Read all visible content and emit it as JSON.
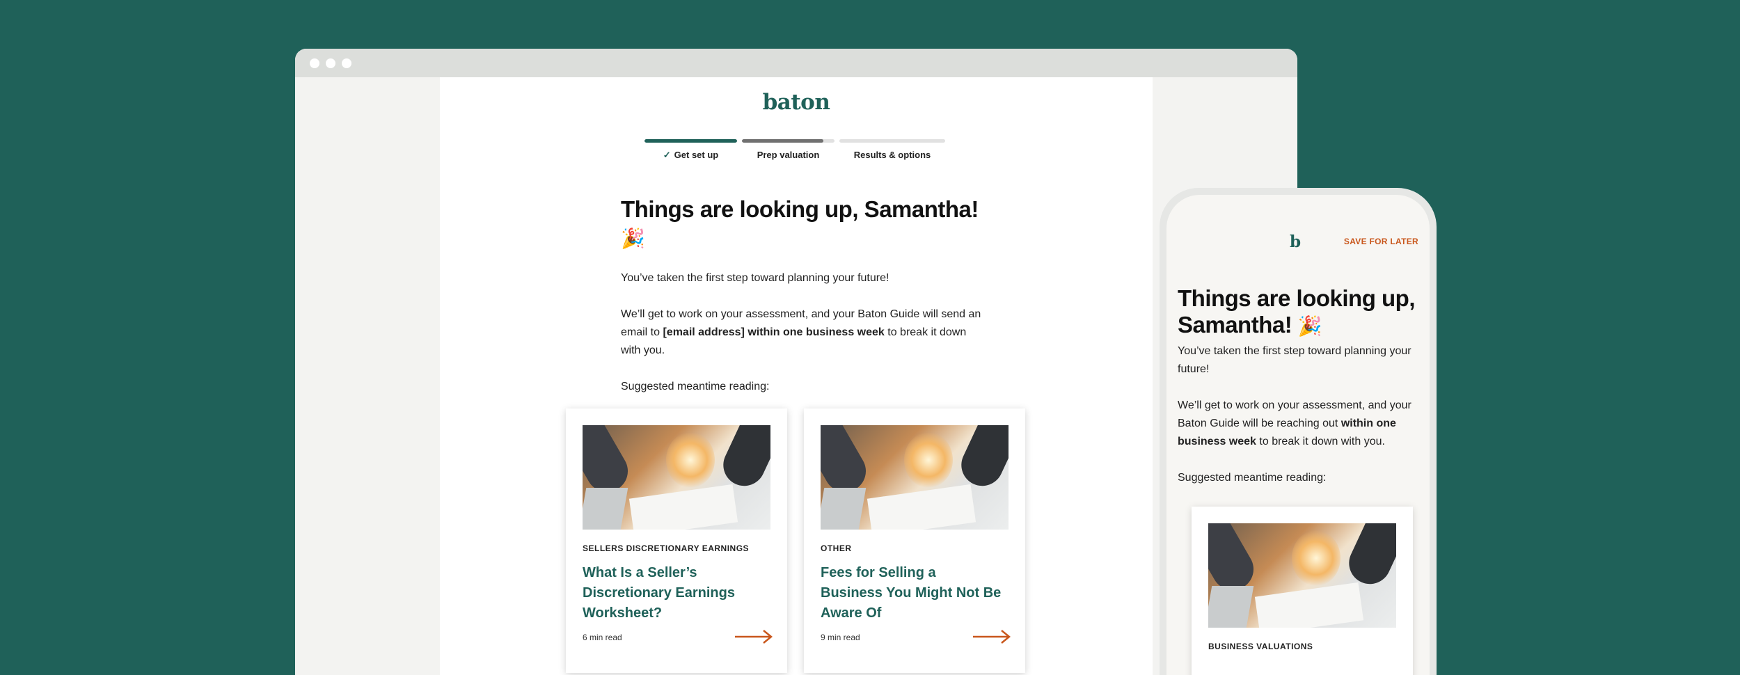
{
  "desktop": {
    "logo": "baton",
    "steps": [
      {
        "label": "Get set up",
        "progress": 1.0
      },
      {
        "label": "Prep valuation",
        "progress": 0.88
      },
      {
        "label": "Results & options",
        "progress": 0.0
      }
    ],
    "headline": "Things are looking up, Samantha!",
    "emoji": "🎉",
    "para1": "You’ve taken the first step toward planning your future!",
    "para2_start": "We’ll get to work on your assessment, and your Baton Guide will send an email to ",
    "para2_email": "[email address]",
    "para2_mid": " ",
    "para2_bold": "within one business week",
    "para2_end": " to break it down with you.",
    "reading_label": "Suggested meantime reading:",
    "cards": [
      {
        "tag": "SELLERS DISCRETIONARY EARNINGS",
        "title": "What Is a Seller’s Discretionary Earnings Worksheet?",
        "meta": "6 min read",
        "arrow_icon": "arrow-right-icon"
      },
      {
        "tag": "OTHER",
        "title": "Fees for Selling a Business You Might Not Be Aware Of",
        "meta": "9 min read",
        "arrow_icon": "arrow-right-icon"
      }
    ]
  },
  "mobile": {
    "logo": "b",
    "save_label": "SAVE FOR LATER",
    "headline": "Things are looking up, Samantha!",
    "emoji": "🎉",
    "para1": "You’ve taken the first step toward planning your future!",
    "para2_start": "We’ll get to work on your assessment, and your Baton Guide will be reaching out ",
    "para2_bold": "within one business week",
    "para2_end": " to break it down with you.",
    "reading_label": "Suggested meantime reading:",
    "card": {
      "tag": "BUSINESS VALUATIONS"
    }
  },
  "colors": {
    "brand": "#1f6159",
    "accent": "#c9571c",
    "background": "#1f6159"
  }
}
